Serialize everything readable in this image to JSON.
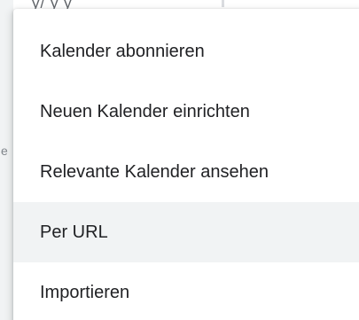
{
  "background": {
    "fragment_top": "y/ y y",
    "fragment_left": "e"
  },
  "menu": {
    "items": [
      {
        "label": "Kalender abonnieren"
      },
      {
        "label": "Neuen Kalender einrichten"
      },
      {
        "label": "Relevante Kalender ansehen"
      },
      {
        "label": "Per URL",
        "hovered": true
      },
      {
        "label": "Importieren"
      }
    ]
  },
  "colors": {
    "menu_background": "#ffffff",
    "hover_background": "#f1f3f4",
    "text": "#202124"
  }
}
